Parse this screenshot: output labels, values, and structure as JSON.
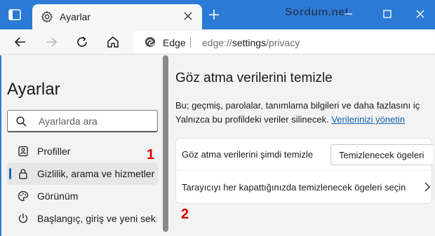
{
  "tab": {
    "title": "Ayarlar"
  },
  "watermark": "Sordum.net",
  "address": {
    "site_label": "Edge",
    "url_prefix": "edge://",
    "url_bold": "settings",
    "url_suffix": "/privacy"
  },
  "sidebar": {
    "title": "Ayarlar",
    "search_placeholder": "Ayarlarda ara",
    "items": [
      {
        "label": "Profiller",
        "icon": "profile-icon"
      },
      {
        "label": "Gizlilik, arama ve hizmetler",
        "icon": "lock-icon",
        "active": true
      },
      {
        "label": "Görünüm",
        "icon": "palette-icon"
      },
      {
        "label": "Başlangıç, giriş ve yeni sekme",
        "icon": "power-icon"
      }
    ]
  },
  "markers": {
    "one": "1",
    "two": "2"
  },
  "main": {
    "heading": "Göz atma verilerini temizle",
    "desc_line1": "Bu; geçmiş, parolalar, tanımlama bilgileri ve daha fazlasını iç",
    "desc_line2": "Yalnızca bu profildeki veriler silinecek.",
    "desc_link": "Verilerinizi yönetin",
    "clear_now_label": "Göz atma verilerini şimdi temizle",
    "clear_button": "Temizlenecek ögeleri",
    "on_close_label": "Tarayıcıyı her kapattığınızda temizlenecek ögeleri seçin"
  },
  "colors": {
    "titlebar": "#2b7bd6",
    "accent": "#0f6cbd",
    "marker": "#e00000"
  }
}
